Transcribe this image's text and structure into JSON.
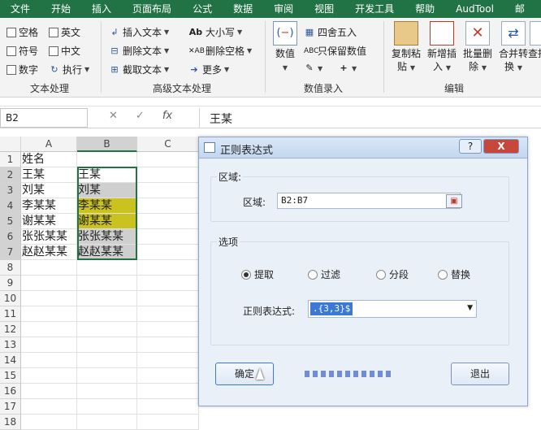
{
  "tabs": [
    "文件",
    "开始",
    "插入",
    "页面布局",
    "公式",
    "数据",
    "审阅",
    "视图",
    "开发工具",
    "帮助",
    "AudTool",
    "邮"
  ],
  "ribbon": {
    "text_processing": {
      "checkboxes": [
        "空格",
        "英文",
        "符号",
        "中文",
        "数字"
      ],
      "execute": "执行",
      "label": "文本处理"
    },
    "advanced": {
      "insert_text": "插入文本",
      "delete_text": "删除文本",
      "extract_text": "截取文本",
      "case": "大小写",
      "delete_space": "删除空格",
      "more": "更多",
      "label": "高级文本处理"
    },
    "numeric": {
      "value": "数值",
      "round": "四舍五入",
      "keep_value": "只保留数值",
      "label": "数值录入"
    },
    "edit": {
      "copy_paste": [
        "复制粘",
        "贴"
      ],
      "new_insert": [
        "新增插",
        "入"
      ],
      "batch_delete": [
        "批量删",
        "除"
      ],
      "merge_convert": [
        "合并转",
        "换"
      ],
      "find": [
        "查找",
        ""
      ],
      "label": "编辑"
    }
  },
  "formula_bar": {
    "name_box": "B2",
    "cancel": "✕",
    "enter": "✓",
    "fx": "fx",
    "content": "王某"
  },
  "grid": {
    "columns": [
      "A",
      "B",
      "C"
    ],
    "rows": [
      "1",
      "2",
      "3",
      "4",
      "5",
      "6",
      "7",
      "8",
      "9",
      "10",
      "11",
      "12",
      "13",
      "14",
      "15",
      "16",
      "17",
      "18"
    ],
    "col_a": [
      "姓名",
      "王某",
      "刘某",
      "李某某",
      "谢某某",
      "张张某某",
      "赵赵某某"
    ],
    "col_b": [
      "",
      "王某",
      "刘某",
      "李某某",
      "谢某某",
      "张张某某",
      "赵赵某某"
    ]
  },
  "dialog": {
    "title": "正则表达式",
    "help": "?",
    "close": "X",
    "range_group": "区域:",
    "range_label": "区域:",
    "range_value": "B2:B7",
    "options_group": "选项",
    "options": [
      "提取",
      "过滤",
      "分段",
      "替换"
    ],
    "selected_option": "提取",
    "regex_label": "正则表达式:",
    "regex_value": ".{3,3}$",
    "ok": "确定",
    "cancel": "退出"
  }
}
